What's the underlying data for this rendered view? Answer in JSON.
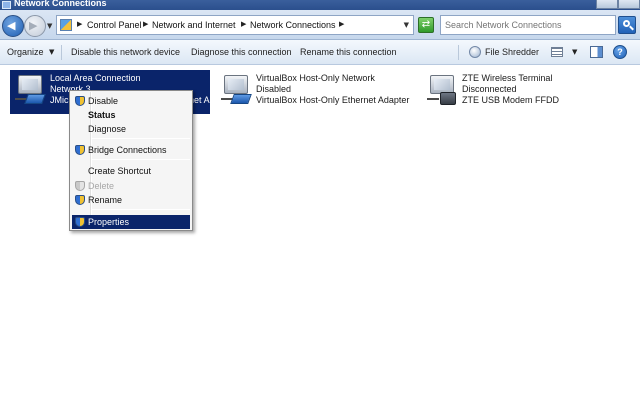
{
  "window": {
    "title": "Network Connections"
  },
  "address": {
    "crumbs": [
      "Control Panel",
      "Network and Internet",
      "Network Connections"
    ]
  },
  "search": {
    "placeholder": "Search Network Connections"
  },
  "toolbar": {
    "organize": "Organize",
    "disable_device": "Disable this network device",
    "diagnose": "Diagnose this connection",
    "rename": "Rename this connection",
    "file_shredder": "File Shredder"
  },
  "connections": [
    {
      "name": "Local Area Connection",
      "status": "Network 3",
      "device": "JMicron PCI Express Gigabit Ethernet Adapter",
      "icon": "ethernet-adapter-icon",
      "selected": true
    },
    {
      "name": "VirtualBox Host-Only Network",
      "status": "Disabled",
      "device": "VirtualBox Host-Only Ethernet Adapter",
      "icon": "ethernet-adapter-icon",
      "selected": false
    },
    {
      "name": "ZTE Wireless Terminal",
      "status": "Disconnected",
      "device": "ZTE USB Modem FFDD",
      "icon": "modem-icon",
      "selected": false
    }
  ],
  "context_menu": {
    "items": [
      {
        "label": "Disable",
        "icon": "shield-icon"
      },
      {
        "label": "Status",
        "bold": true
      },
      {
        "label": "Diagnose"
      },
      {
        "label": "Bridge Connections",
        "icon": "shield-icon"
      },
      {
        "label": "Create Shortcut"
      },
      {
        "label": "Delete",
        "icon": "shield-icon",
        "disabled": true
      },
      {
        "label": "Rename",
        "icon": "shield-icon"
      },
      {
        "label": "Properties",
        "icon": "shield-icon",
        "highlighted": true
      }
    ]
  },
  "colors": {
    "selection": "#0a246a",
    "titlebar": "#2b4f8d",
    "toolbar_bg": "#dce7f4"
  }
}
